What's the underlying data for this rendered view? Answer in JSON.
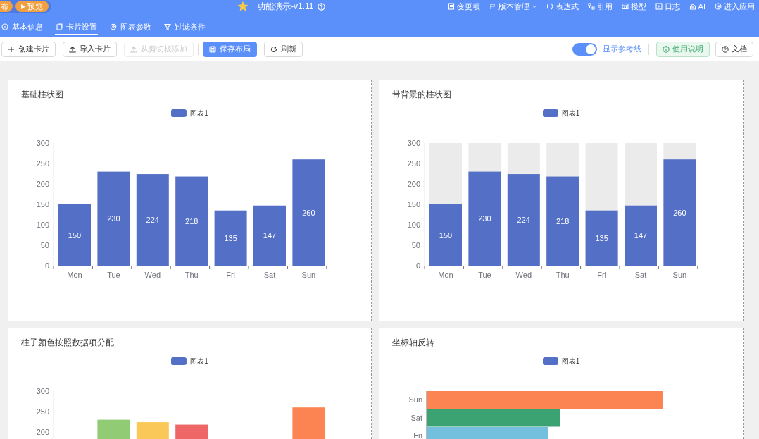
{
  "header": {
    "publish_button": "布",
    "preview_button": "预览",
    "title": "功能演示-v1.11",
    "menu": [
      {
        "kind": "changes",
        "label": "变更项"
      },
      {
        "kind": "versions",
        "label": "版本管理"
      },
      {
        "kind": "expression",
        "label": "表达式"
      },
      {
        "kind": "reference",
        "label": "引用"
      },
      {
        "kind": "model",
        "label": "模型"
      },
      {
        "kind": "log",
        "label": "日志"
      },
      {
        "kind": "ai",
        "label": "AI"
      },
      {
        "kind": "enter",
        "label": "进入应用"
      }
    ]
  },
  "tabs": [
    {
      "kind": "info",
      "label": "基本信息",
      "selected": false
    },
    {
      "kind": "card",
      "label": "卡片设置",
      "selected": true
    },
    {
      "kind": "params",
      "label": "图表参数",
      "selected": false
    },
    {
      "kind": "filter",
      "label": "过滤条件",
      "selected": false
    }
  ],
  "toolbar": {
    "buttons": [
      {
        "kind": "create",
        "label": "创建卡片",
        "disabled": false
      },
      {
        "kind": "import",
        "label": "导入卡片",
        "disabled": false
      },
      {
        "kind": "paste",
        "label": "从剪切板添加",
        "disabled": true
      },
      {
        "kind": "save",
        "label": "保存布局",
        "disabled": false
      },
      {
        "kind": "refresh",
        "label": "刷新",
        "disabled": false
      }
    ],
    "guide_toggle": {
      "label": "显示参考线",
      "on": true
    },
    "help_button": "使用说明",
    "docs_button": "文档"
  },
  "cards": [
    {
      "kind": "bar",
      "title": "基础柱状图",
      "background_bars": false,
      "chart_data": {
        "type": "bar",
        "categories": [
          "Mon",
          "Tue",
          "Wed",
          "Thu",
          "Fri",
          "Sat",
          "Sun"
        ],
        "series": [
          {
            "name": "图表1",
            "color": "#5470c6",
            "values": [
              150,
              230,
              224,
              218,
              135,
              147,
              260
            ]
          }
        ],
        "ylim": [
          0,
          300
        ],
        "yticks": [
          0,
          50,
          100,
          150,
          200,
          250,
          300
        ],
        "data_labels": true
      }
    },
    {
      "kind": "bar",
      "title": "带背景的柱状图",
      "background_bars": true,
      "chart_data": {
        "type": "bar",
        "categories": [
          "Mon",
          "Tue",
          "Wed",
          "Thu",
          "Fri",
          "Sat",
          "Sun"
        ],
        "series": [
          {
            "name": "图表1",
            "color": "#5470c6",
            "values": [
              150,
              230,
              224,
              218,
              135,
              147,
              260
            ]
          }
        ],
        "ylim": [
          0,
          300
        ],
        "yticks": [
          0,
          50,
          100,
          150,
          200,
          250,
          300
        ],
        "data_labels": true
      }
    },
    {
      "kind": "bar",
      "title": "柱子颜色按照数据项分配",
      "background_bars": false,
      "legend": {
        "color": "#5470c6"
      },
      "bars": [
        {
          "color": "#91cc75"
        },
        {
          "color": "#fac858"
        },
        {
          "color": "#ee6666"
        },
        {
          "color": "#fc8452"
        }
      ],
      "chart_data": {
        "type": "bar",
        "series": [
          {
            "name": "图表1",
            "values": [
              null,
              230,
              224,
              218,
              null,
              null,
              260
            ]
          }
        ],
        "ylim": [
          0,
          300
        ],
        "yticks": [
          200,
          250,
          300
        ]
      }
    },
    {
      "kind": "horizontal",
      "title": "坐标轴反转",
      "legend": {
        "name": "图表1",
        "color": "#5470c6"
      },
      "bars": [
        {
          "label": "Sun",
          "color": "#fc8452"
        },
        {
          "label": "Sat",
          "color": "#3ba272"
        },
        {
          "label": "Fri",
          "color": "#73c0de"
        }
      ]
    }
  ]
}
